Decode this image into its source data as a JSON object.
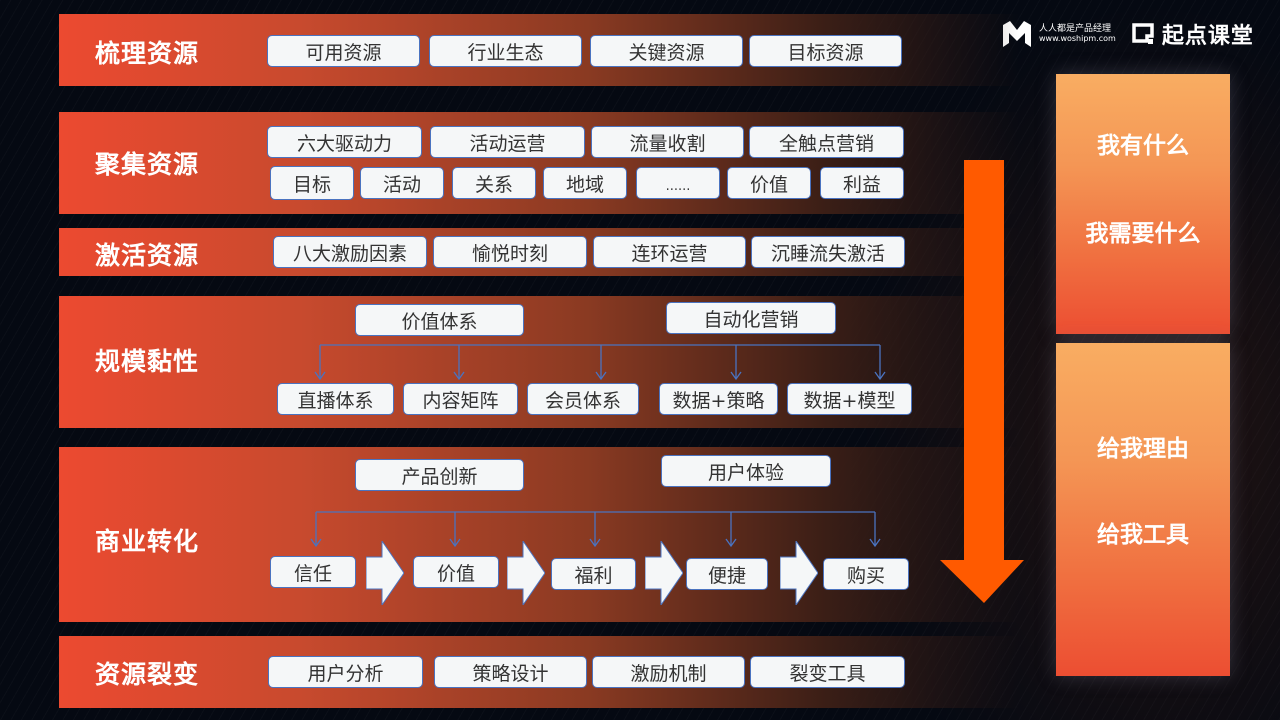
{
  "logo": {
    "woshipm_name": "人人都是产品经理",
    "woshipm_url": "www.woshipm.com",
    "brand_name": "起点课堂"
  },
  "colors": {
    "row_gradient_start": "#ec4a30",
    "arrow": "#ff5a00",
    "card_top": "#f9ad62",
    "card_bottom": "#ec4e32",
    "pill_border": "#4a73c0",
    "connector_line": "#4a73c0"
  },
  "rows": [
    {
      "title": "梳理资源",
      "items": [
        "可用资源",
        "行业生态",
        "关键资源",
        "目标资源"
      ]
    },
    {
      "title": "聚集资源",
      "items_row1": [
        "六大驱动力",
        "活动运营",
        "流量收割",
        "全触点营销"
      ],
      "items_row2": [
        "目标",
        "活动",
        "关系",
        "地域",
        "......",
        "价值",
        "利益"
      ]
    },
    {
      "title": "激活资源",
      "items": [
        "八大激励因素",
        "愉悦时刻",
        "连环运营",
        "沉睡流失激活"
      ]
    },
    {
      "title": "规模黏性",
      "top_items": [
        "价值体系",
        "自动化营销"
      ],
      "bottom_items": [
        "直播体系",
        "内容矩阵",
        "会员体系",
        "数据+策略",
        "数据+模型"
      ]
    },
    {
      "title": "商业转化",
      "top_items": [
        "产品创新",
        "用户体验"
      ],
      "flow_items": [
        "信任",
        "价值",
        "福利",
        "便捷",
        "购买"
      ]
    },
    {
      "title": "资源裂变",
      "items": [
        "用户分析",
        "策略设计",
        "激励机制",
        "裂变工具"
      ]
    }
  ],
  "side_cards": [
    {
      "lines": [
        "我有什么",
        "我需要什么"
      ]
    },
    {
      "lines": [
        "给我理由",
        "给我工具"
      ]
    }
  ]
}
